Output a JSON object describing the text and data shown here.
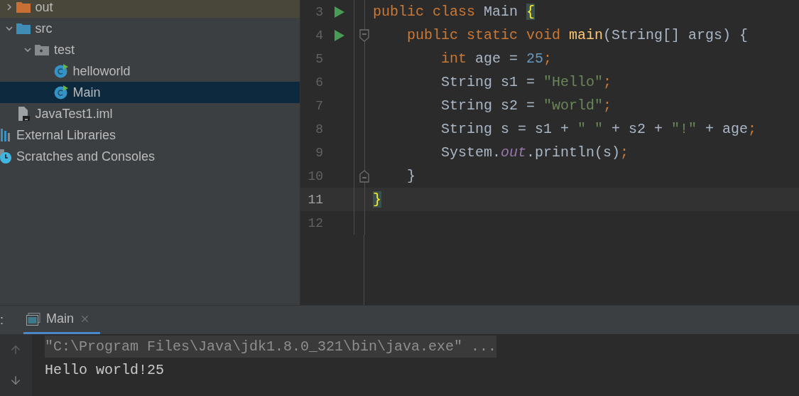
{
  "project_tree": {
    "project_items": [
      {
        "label": "out",
        "kind": "excluded-folder",
        "expanded": false,
        "selected": false
      },
      {
        "label": "src",
        "kind": "source-folder",
        "expanded": true,
        "selected": false,
        "children": [
          {
            "label": "test",
            "kind": "package",
            "expanded": true,
            "selected": false,
            "children": [
              {
                "label": "helloworld",
                "kind": "class",
                "selected": false
              },
              {
                "label": "Main",
                "kind": "class",
                "selected": true
              }
            ]
          }
        ]
      },
      {
        "label": "JavaTest1.iml",
        "kind": "module-file",
        "selected": false
      }
    ],
    "root_items": [
      {
        "label": "External Libraries",
        "kind": "libraries",
        "selected": false
      },
      {
        "label": "Scratches and Consoles",
        "kind": "scratches",
        "selected": false
      }
    ]
  },
  "editor": {
    "lines": [
      {
        "number": "3",
        "run": true,
        "fold_start": false,
        "fold_end": false,
        "current": false,
        "tokens": [
          {
            "text": "public class ",
            "kind": "keyword"
          },
          {
            "text": "Main ",
            "kind": "plain"
          },
          {
            "text": "{",
            "kind": "brace-match"
          }
        ]
      },
      {
        "number": "4",
        "run": true,
        "fold_start": true,
        "fold_end": false,
        "current": false,
        "tokens": [
          {
            "text": "    public static void ",
            "kind": "keyword"
          },
          {
            "text": "main",
            "kind": "method"
          },
          {
            "text": "(String[] args) {",
            "kind": "plain"
          }
        ]
      },
      {
        "number": "5",
        "run": false,
        "fold_start": false,
        "fold_end": false,
        "current": false,
        "tokens": [
          {
            "text": "        int ",
            "kind": "keyword"
          },
          {
            "text": "age = ",
            "kind": "plain"
          },
          {
            "text": "25",
            "kind": "number"
          },
          {
            "text": ";",
            "kind": "keyword"
          }
        ]
      },
      {
        "number": "6",
        "run": false,
        "fold_start": false,
        "fold_end": false,
        "current": false,
        "tokens": [
          {
            "text": "        String s1 = ",
            "kind": "plain"
          },
          {
            "text": "\"Hello\"",
            "kind": "string"
          },
          {
            "text": ";",
            "kind": "keyword"
          }
        ]
      },
      {
        "number": "7",
        "run": false,
        "fold_start": false,
        "fold_end": false,
        "current": false,
        "tokens": [
          {
            "text": "        String s2 = ",
            "kind": "plain"
          },
          {
            "text": "\"world\"",
            "kind": "string"
          },
          {
            "text": ";",
            "kind": "keyword"
          }
        ]
      },
      {
        "number": "8",
        "run": false,
        "fold_start": false,
        "fold_end": false,
        "current": false,
        "tokens": [
          {
            "text": "        String s = s1 + ",
            "kind": "plain"
          },
          {
            "text": "\" \"",
            "kind": "string"
          },
          {
            "text": " + s2 + ",
            "kind": "plain"
          },
          {
            "text": "\"!\"",
            "kind": "string"
          },
          {
            "text": " + age",
            "kind": "plain"
          },
          {
            "text": ";",
            "kind": "keyword"
          }
        ]
      },
      {
        "number": "9",
        "run": false,
        "fold_start": false,
        "fold_end": false,
        "current": false,
        "tokens": [
          {
            "text": "        System.",
            "kind": "plain"
          },
          {
            "text": "out",
            "kind": "field"
          },
          {
            "text": ".println(s)",
            "kind": "plain"
          },
          {
            "text": ";",
            "kind": "keyword"
          }
        ]
      },
      {
        "number": "10",
        "run": false,
        "fold_start": false,
        "fold_end": true,
        "current": false,
        "tokens": [
          {
            "text": "    }",
            "kind": "plain"
          }
        ]
      },
      {
        "number": "11",
        "run": false,
        "fold_start": false,
        "fold_end": false,
        "current": true,
        "tokens": [
          {
            "text": "}",
            "kind": "brace-match"
          }
        ]
      },
      {
        "number": "12",
        "run": false,
        "fold_start": false,
        "fold_end": false,
        "current": false
      }
    ]
  },
  "run_panel": {
    "label": ":",
    "tabs": [
      {
        "title": "Main",
        "selected": true
      }
    ],
    "console": [
      {
        "text": "\"C:\\Program Files\\Java\\jdk1.8.0_321\\bin\\java.exe\" ...",
        "kind": "command"
      },
      {
        "text": "Hello world!25",
        "kind": "output"
      }
    ]
  }
}
